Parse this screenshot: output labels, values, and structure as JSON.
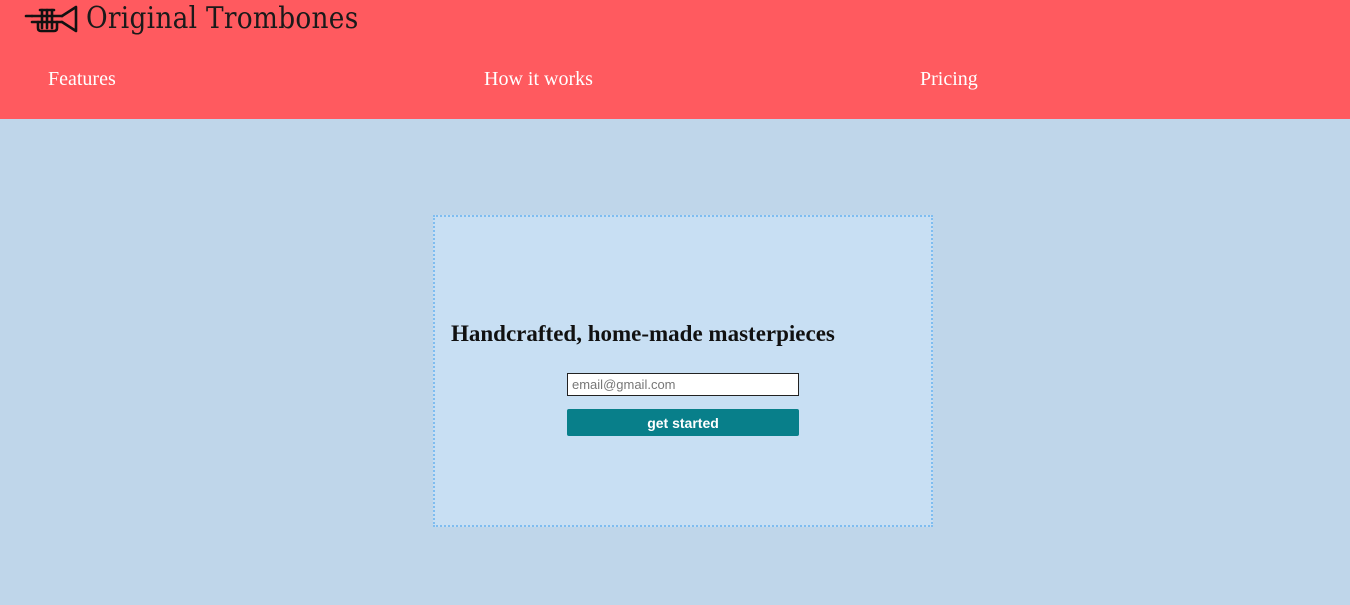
{
  "header": {
    "logo_icon": "trumpet-icon",
    "brand_name": "Original Trombones",
    "nav": {
      "features": "Features",
      "how_it_works": "How it works",
      "pricing": "Pricing"
    }
  },
  "hero": {
    "title": "Handcrafted, home-made masterpieces",
    "email_placeholder": "email@gmail.com",
    "email_value": "",
    "cta_label": "get started"
  },
  "colors": {
    "header_bg": "#ff5a5f",
    "page_bg": "#bfd6ea",
    "hero_bg": "#c8dff3",
    "button_bg": "#087f8a",
    "nav_text": "#ffffff"
  }
}
